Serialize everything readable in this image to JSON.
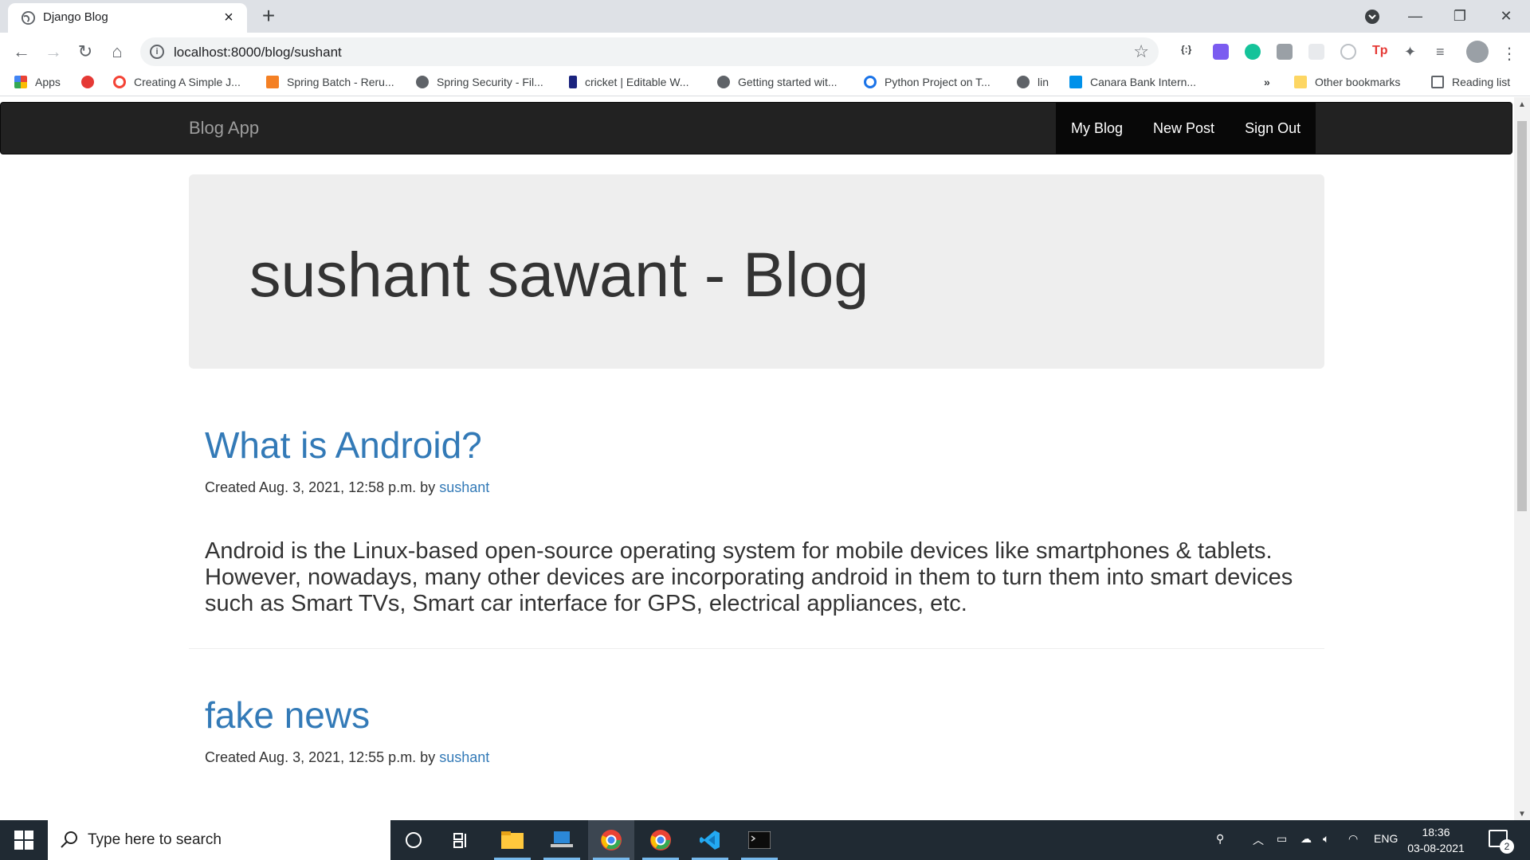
{
  "browser": {
    "tab_title": "Django Blog",
    "url": "localhost:8000/blog/sushant",
    "bookmarks": [
      {
        "label": "Apps",
        "color": "#ea4335"
      },
      {
        "label": "",
        "color": "#e53935"
      },
      {
        "label": "Creating A Simple J...",
        "color": "#f44336"
      },
      {
        "label": "Spring Batch - Reru...",
        "color": "#f48024"
      },
      {
        "label": "Spring Security - Fil...",
        "color": "#5f6368"
      },
      {
        "label": "cricket | Editable W...",
        "color": "#1a237e"
      },
      {
        "label": "Getting started wit...",
        "color": "#5f6368"
      },
      {
        "label": "Python Project on T...",
        "color": "#1a73e8"
      },
      {
        "label": "lin",
        "color": "#5f6368"
      },
      {
        "label": "Canara Bank Intern...",
        "color": "#0091ea"
      }
    ],
    "overflow_chevron": "»",
    "other_bookmarks": "Other bookmarks",
    "reading_list": "Reading list"
  },
  "app": {
    "brand": "Blog App",
    "nav": [
      "My Blog",
      "New Post",
      "Sign Out"
    ],
    "jumbotron_title": "sushant sawant - Blog"
  },
  "posts": [
    {
      "title": "What is Android?",
      "created_prefix": "Created Aug. 3, 2021, 12:58 p.m. by",
      "author": "sushant",
      "body": "Android is the Linux-based open-source operating system for mobile devices like smartphones & tablets. However, nowadays, many other devices are incorporating android in them to turn them into smart devices such as Smart TVs, Smart car interface for GPS, electrical appliances, etc."
    },
    {
      "title": "fake news",
      "created_prefix": "Created Aug. 3, 2021, 12:55 p.m. by",
      "author": "sushant",
      "body": ""
    }
  ],
  "taskbar": {
    "search_placeholder": "Type here to search",
    "language": "ENG",
    "time": "18:36",
    "date": "03-08-2021",
    "notification_count": "2"
  },
  "colors": {
    "link": "#337ab7",
    "navbar_bg": "#222222",
    "jumbotron_bg": "#eeeeee",
    "taskbar_bg": "#202a33"
  }
}
